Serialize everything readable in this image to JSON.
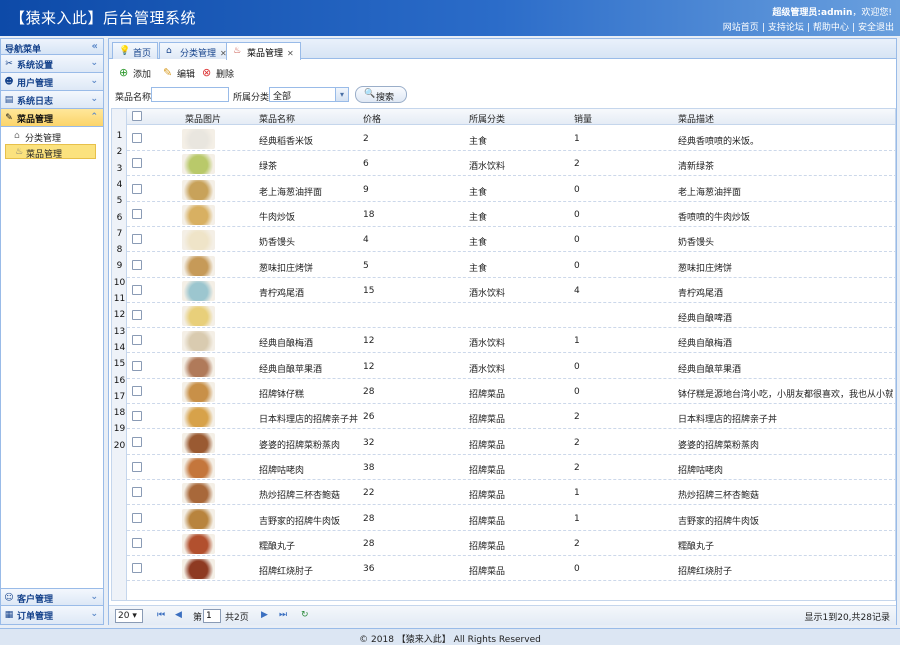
{
  "header": {
    "title": "【猿来入此】后台管理系统",
    "welcome_prefix": "超级管理员:",
    "welcome_user": "admin",
    "welcome_suffix": "，欢迎您!",
    "links": [
      "网站首页",
      "支持论坛",
      "帮助中心",
      "安全退出"
    ]
  },
  "sidebar": {
    "title": "导航菜单",
    "items": [
      {
        "label": "系统设置",
        "icon": "tools-icon"
      },
      {
        "label": "用户管理",
        "icon": "user-icon"
      },
      {
        "label": "系统日志",
        "icon": "log-icon"
      },
      {
        "label": "菜品管理",
        "icon": "dish-icon"
      }
    ],
    "sub_items": [
      "分类管理",
      "菜品管理"
    ],
    "bottom_items": [
      {
        "label": "客户管理",
        "icon": "customer-icon"
      },
      {
        "label": "订单管理",
        "icon": "order-icon"
      }
    ]
  },
  "tabs": [
    {
      "label": "首页"
    },
    {
      "label": "分类管理"
    },
    {
      "label": "菜品管理"
    }
  ],
  "toolbar": {
    "add": "添加",
    "edit": "编辑",
    "delete": "删除"
  },
  "search": {
    "name_label": "菜品名称:",
    "name_value": "",
    "category_label": "所属分类:",
    "category_value": "全部",
    "button": "搜索"
  },
  "grid": {
    "columns": [
      "菜品图片",
      "菜品名称",
      "价格",
      "所属分类",
      "销量",
      "菜品描述"
    ],
    "row_numbers": [
      "1",
      "2",
      "3",
      "4",
      "5",
      "6",
      "7",
      "8",
      "9",
      "10",
      "11",
      "12",
      "13",
      "14",
      "15",
      "16",
      "17",
      "18",
      "19",
      "20"
    ],
    "rows": [
      {
        "name": "经典稻香米饭",
        "price": "2",
        "category": "主食",
        "sales": "1",
        "desc": "经典香喷喷的米饭。",
        "color": "#e9e6df"
      },
      {
        "name": "绿茶",
        "price": "6",
        "category": "酒水饮料",
        "sales": "2",
        "desc": "清新绿茶",
        "color": "#b9c96a"
      },
      {
        "name": "老上海葱油拌面",
        "price": "9",
        "category": "主食",
        "sales": "0",
        "desc": "老上海葱油拌面",
        "color": "#c8a25a"
      },
      {
        "name": "牛肉炒饭",
        "price": "18",
        "category": "主食",
        "sales": "0",
        "desc": "香喷喷的牛肉炒饭",
        "color": "#d8b062"
      },
      {
        "name": "奶香馒头",
        "price": "4",
        "category": "主食",
        "sales": "0",
        "desc": "奶香馒头",
        "color": "#efe4c8"
      },
      {
        "name": "葱味扣庄烤饼",
        "price": "5",
        "category": "主食",
        "sales": "0",
        "desc": "葱味扣庄烤饼",
        "color": "#c69a58"
      },
      {
        "name": "青柠鸡尾酒",
        "price": "15",
        "category": "酒水饮料",
        "sales": "4",
        "desc": "青柠鸡尾酒",
        "color": "#9cc6cf"
      },
      {
        "name": "",
        "price": "",
        "category": "",
        "sales": "",
        "desc": "经典自酿啤酒",
        "color": "#e8cf7a"
      },
      {
        "name": "经典自酿梅酒",
        "price": "12",
        "category": "酒水饮料",
        "sales": "1",
        "desc": "经典自酿梅酒",
        "color": "#d9cbb0"
      },
      {
        "name": "经典自酿苹果酒",
        "price": "12",
        "category": "酒水饮料",
        "sales": "0",
        "desc": "经典自酿苹果酒",
        "color": "#b07a5a"
      },
      {
        "name": "招牌钵仔糕",
        "price": "28",
        "category": "招牌菜品",
        "sales": "0",
        "desc": "钵仔糕是源地台湾小吃，小朋友都很喜欢，我也从小就爱吃",
        "color": "#c89048"
      },
      {
        "name": "日本料理店的招牌亲子丼",
        "price": "26",
        "category": "招牌菜品",
        "sales": "2",
        "desc": "日本料理店的招牌亲子丼",
        "color": "#d7a24a"
      },
      {
        "name": "婆婆的招牌菜粉蒸肉",
        "price": "32",
        "category": "招牌菜品",
        "sales": "2",
        "desc": "婆婆的招牌菜粉蒸肉",
        "color": "#9a5a32"
      },
      {
        "name": "招牌咕咾肉",
        "price": "38",
        "category": "招牌菜品",
        "sales": "2",
        "desc": "招牌咕咾肉",
        "color": "#c4763c"
      },
      {
        "name": "热炒招牌三杯杏鲍菇",
        "price": "22",
        "category": "招牌菜品",
        "sales": "1",
        "desc": "热炒招牌三杯杏鲍菇",
        "color": "#a8683a"
      },
      {
        "name": "吉野家的招牌牛肉饭",
        "price": "28",
        "category": "招牌菜品",
        "sales": "1",
        "desc": "吉野家的招牌牛肉饭",
        "color": "#b8843e"
      },
      {
        "name": "糯酿丸子",
        "price": "28",
        "category": "招牌菜品",
        "sales": "2",
        "desc": "糯酿丸子",
        "color": "#b2502e"
      },
      {
        "name": "招牌红烧肘子",
        "price": "36",
        "category": "招牌菜品",
        "sales": "0",
        "desc": "招牌红烧肘子",
        "color": "#8e3a22"
      }
    ]
  },
  "pager": {
    "page_size": "20",
    "page_prefix": "第",
    "page_value": "1",
    "page_total": "共2页",
    "info": "显示1到20,共28记录"
  },
  "footer": "© 2018 【猿来入此】 All Rights Reserved"
}
